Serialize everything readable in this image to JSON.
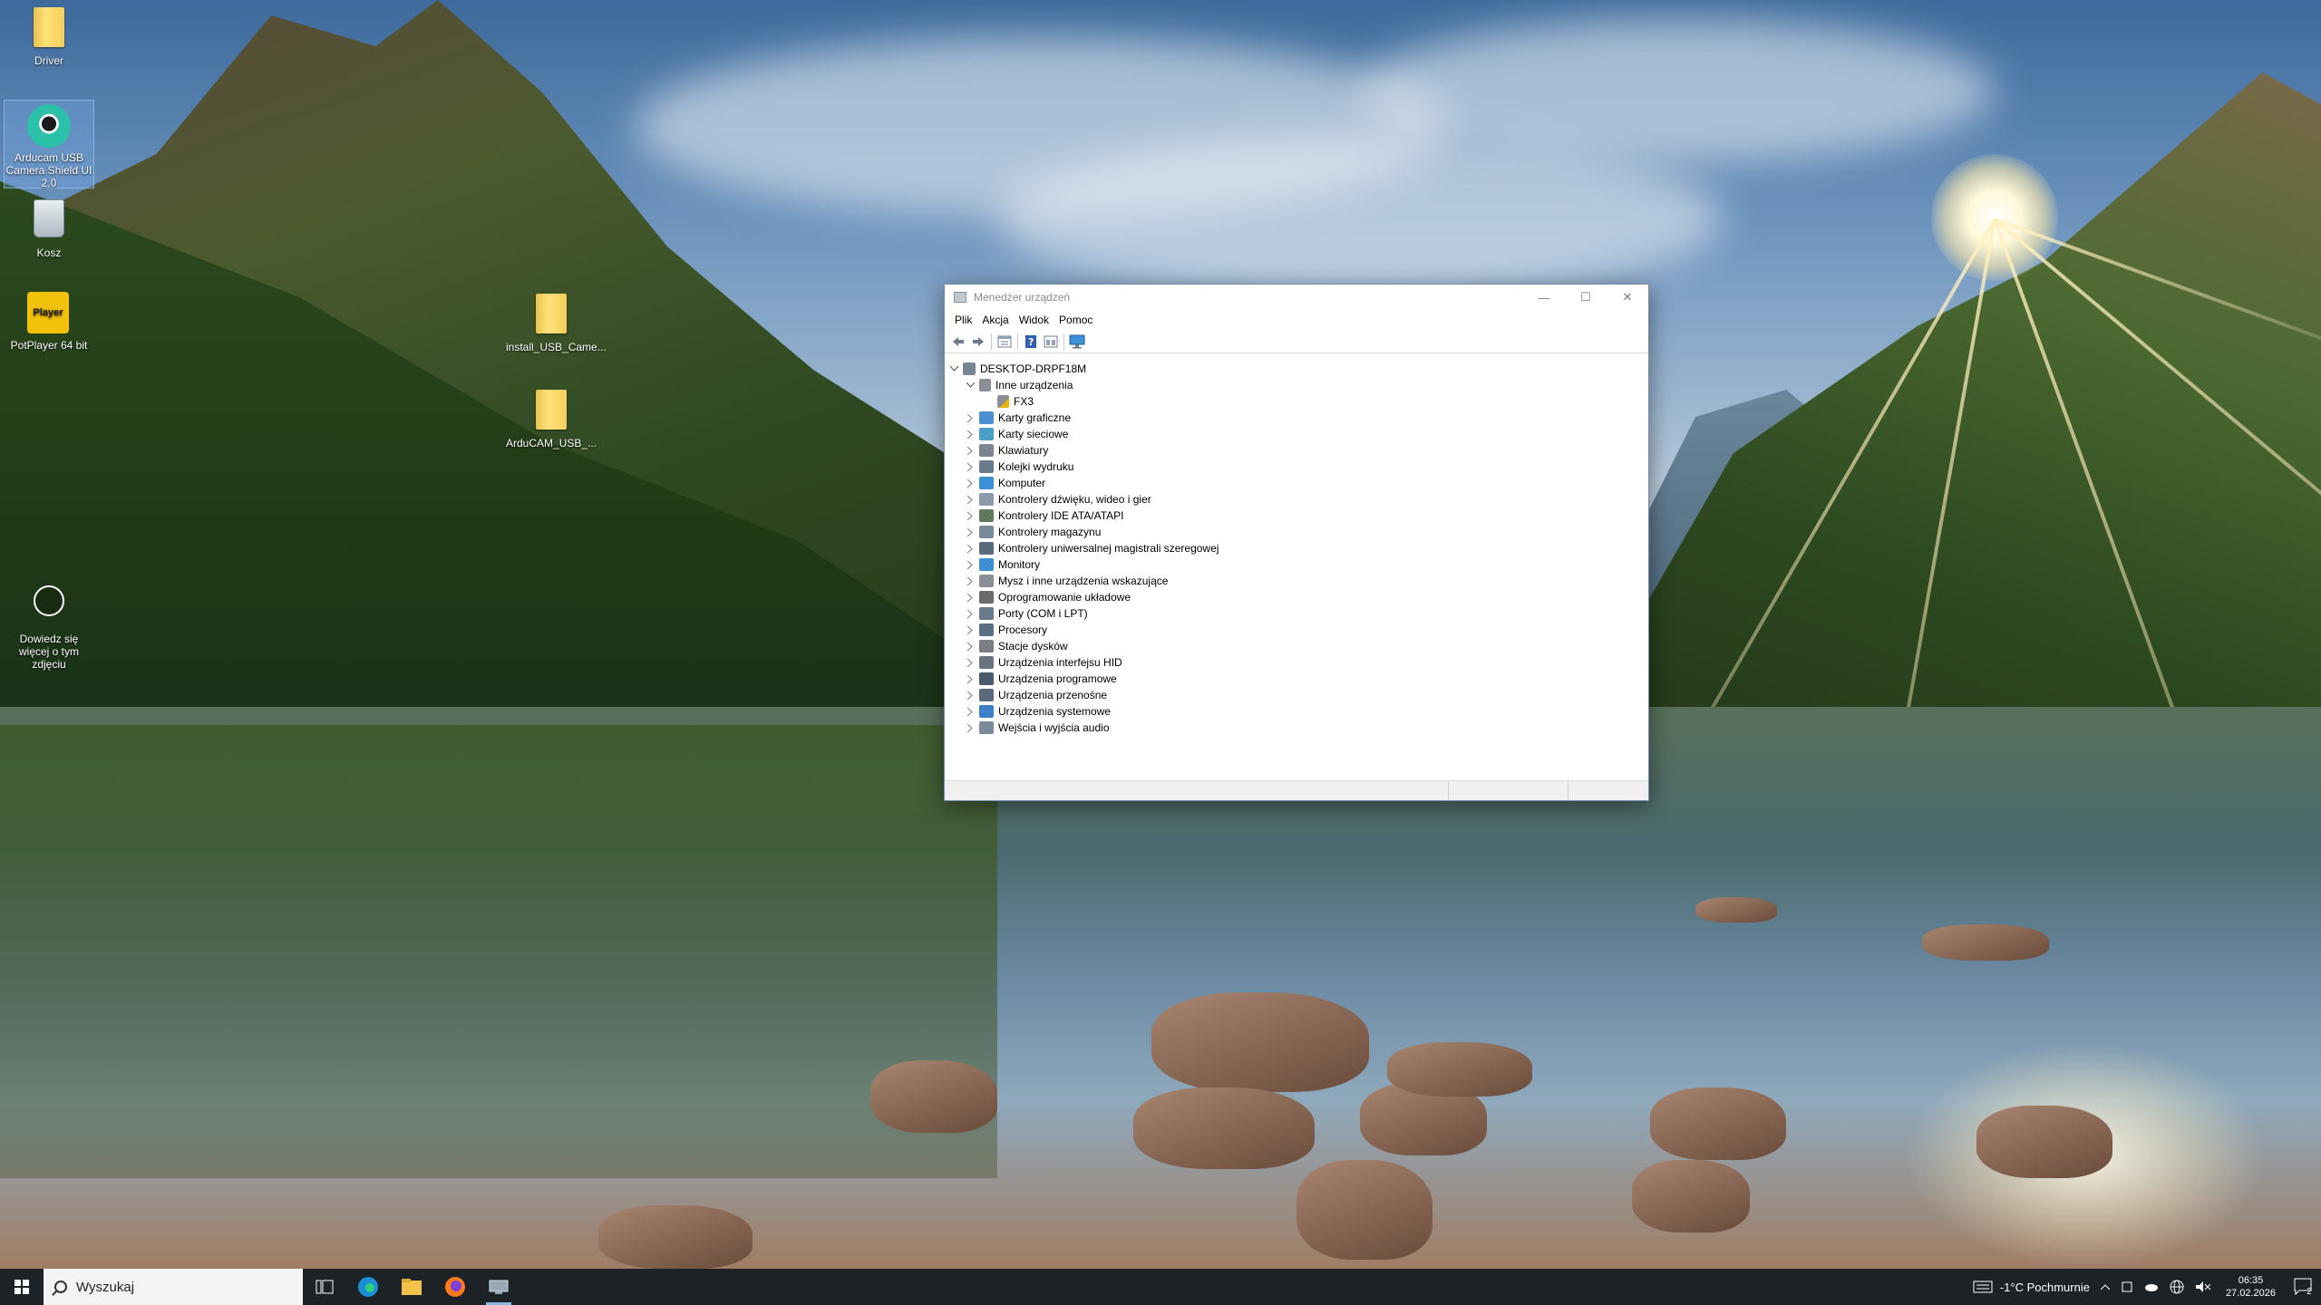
{
  "desktop": {
    "icons": [
      {
        "label": "Driver"
      },
      {
        "label": "Arducam USB Camera Shield UI 2.0"
      },
      {
        "label": "Kosz"
      },
      {
        "label": "PotPlayer 64 bit"
      },
      {
        "label": "install_USB_Came..."
      },
      {
        "label": "ArduCAM_USB_..."
      },
      {
        "label": "Dowiedz się więcej o tym zdjęciu"
      }
    ],
    "potplayer_badge": "Player"
  },
  "window": {
    "title": "Menedżer urządzeń",
    "controls": {
      "minimize": "—",
      "maximize": "☐",
      "close": "✕"
    },
    "menu": [
      "Plik",
      "Akcja",
      "Widok",
      "Pomoc"
    ],
    "toolbar_icons": [
      "back-arrow-icon",
      "forward-arrow-icon",
      "properties-icon",
      "help-icon",
      "view-icon",
      "monitor-icon"
    ],
    "tree": {
      "root": "DESKTOP-DRPF18M",
      "expanded_category": "Inne urządzenia",
      "expanded_child": "FX3",
      "categories": [
        "Karty graficzne",
        "Karty sieciowe",
        "Klawiatury",
        "Kolejki wydruku",
        "Komputer",
        "Kontrolery dźwięku, wideo i gier",
        "Kontrolery IDE ATA/ATAPI",
        "Kontrolery magazynu",
        "Kontrolery uniwersalnej magistrali szeregowej",
        "Monitory",
        "Mysz i inne urządzenia wskazujące",
        "Oprogramowanie układowe",
        "Porty (COM i LPT)",
        "Procesory",
        "Stacje dysków",
        "Urządzenia interfejsu HID",
        "Urządzenia programowe",
        "Urządzenia przenośne",
        "Urządzenia systemowe",
        "Wejścia i wyjścia audio"
      ]
    }
  },
  "taskbar": {
    "search_placeholder": "Wyszukaj",
    "apps": [
      "task-view-icon",
      "edge-icon",
      "file-explorer-icon",
      "firefox-icon",
      "device-manager-icon"
    ],
    "weather": "-1°C  Pochmurnie",
    "time": "06:35",
    "date": "27.02.2026",
    "notification_count": "2"
  },
  "colors": {
    "window_border": "#6f8fb0",
    "taskbar_bg": "#1c2226",
    "active_indicator": "#8ab8e6"
  }
}
